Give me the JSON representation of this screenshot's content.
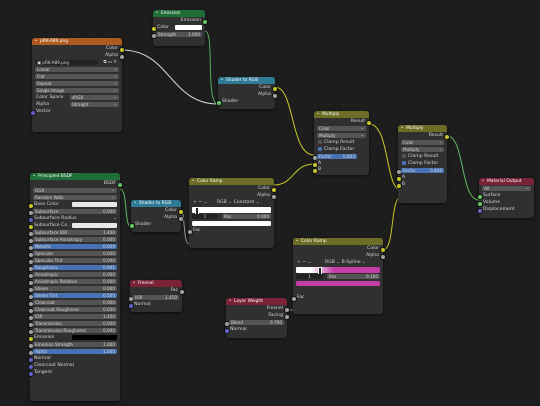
{
  "nodes": {
    "emission": {
      "title": "Emission",
      "out_emission": "Emission",
      "color_label": "Color",
      "strength_label": "Strength",
      "strength_value": "1.000"
    },
    "image": {
      "title": "pRK-A89.png",
      "out_color": "Color",
      "out_alpha": "Alpha",
      "file": "pRK-A89.png",
      "interpolation": "Linear",
      "projection": "Flat",
      "extension": "Repeat",
      "source": "Single Image",
      "cs_label": "Color Space",
      "cs_value": "sRGB",
      "alpha_label": "Alpha",
      "alpha_value": "Straight",
      "in_vector": "Vector"
    },
    "s2r1": {
      "title": "Shader to RGB",
      "out_color": "Color",
      "out_alpha": "Alpha",
      "in_shader": "Shader"
    },
    "multiply1": {
      "title": "Multiply",
      "out_result": "Result",
      "mode_type": "Color",
      "mode_blend": "Multiply",
      "clamp_result": "Clamp Result",
      "clamp_factor": "Clamp Factor",
      "factor_label": "Factor",
      "factor_value": "0.843",
      "in_a": "A",
      "in_b": "B"
    },
    "multiply2": {
      "title": "Multiply",
      "out_result": "Result",
      "mode_type": "Color",
      "mode_blend": "Multiply",
      "clamp_result": "Clamp Result",
      "clamp_factor": "Clamp Factor",
      "factor_label": "Factor",
      "factor_value": "0.848",
      "in_a": "A",
      "in_b": "B"
    },
    "material_output": {
      "title": "Material Output",
      "target": "All",
      "in_surface": "Surface",
      "in_volume": "Volume",
      "in_displacement": "Displacement"
    },
    "bsdf": {
      "title": "Principled BSDF",
      "out_bsdf": "BSDF",
      "distribution": "GGX",
      "subsurface_method": "Random Walk",
      "rows": [
        {
          "label": "Base Color",
          "value": "",
          "kind": "color"
        },
        {
          "label": "Subsurface",
          "value": "0.000",
          "kind": "num"
        },
        {
          "label": "Subsurface Radius",
          "value": "",
          "kind": "vec"
        },
        {
          "label": "Subsurface Co...",
          "value": "",
          "kind": "color"
        },
        {
          "label": "Subsurface IOR",
          "value": "1.400",
          "kind": "num"
        },
        {
          "label": "Subsurface Anisotropy",
          "value": "0.000",
          "kind": "num"
        },
        {
          "label": "Metallic",
          "value": "0.000",
          "kind": "num"
        },
        {
          "label": "Specular",
          "value": "0.000",
          "kind": "num"
        },
        {
          "label": "Specular Tint",
          "value": "0.000",
          "kind": "num"
        },
        {
          "label": "Roughness",
          "value": "0.941",
          "kind": "num"
        },
        {
          "label": "Anisotropic",
          "value": "0.000",
          "kind": "num"
        },
        {
          "label": "Anisotropic Rotation",
          "value": "0.000",
          "kind": "num"
        },
        {
          "label": "Sheen",
          "value": "0.000",
          "kind": "num"
        },
        {
          "label": "Sheen Tint",
          "value": "0.500",
          "kind": "num"
        },
        {
          "label": "Clearcoat",
          "value": "0.000",
          "kind": "num"
        },
        {
          "label": "Clearcoat Roughness",
          "value": "0.030",
          "kind": "num"
        },
        {
          "label": "IOR",
          "value": "1.450",
          "kind": "num"
        },
        {
          "label": "Transmission",
          "value": "0.000",
          "kind": "num"
        },
        {
          "label": "Transmission Roughness",
          "value": "0.000",
          "kind": "num"
        },
        {
          "label": "Emission",
          "value": "",
          "kind": "color"
        },
        {
          "label": "Emission Strength",
          "value": "1.000",
          "kind": "num"
        },
        {
          "label": "Alpha",
          "value": "1.000",
          "kind": "num"
        },
        {
          "label": "Normal",
          "value": "",
          "kind": "sock"
        },
        {
          "label": "Clearcoat Normal",
          "value": "",
          "kind": "sock"
        },
        {
          "label": "Tangent",
          "value": "",
          "kind": "sock"
        }
      ]
    },
    "s2r2": {
      "title": "Shader to RGB",
      "out_color": "Color",
      "out_alpha": "Alpha",
      "in_shader": "Shader"
    },
    "ramp1": {
      "title": "Color Ramp",
      "out_color": "Color",
      "out_alpha": "Alpha",
      "mode": "RGB",
      "interp": "Constant",
      "stop_index": "1",
      "pos_label": "Pos",
      "pos_value": "0.000",
      "in_fac": "Fac"
    },
    "ramp2": {
      "title": "Color Ramp",
      "out_color": "Color",
      "out_alpha": "Alpha",
      "mode": "RGB",
      "interp": "B-Spline",
      "stop_index": "1",
      "pos_label": "Pos",
      "pos_value": "0.100",
      "in_fac": "Fac"
    },
    "fresnel": {
      "title": "Fresnel",
      "out_fac": "Fac",
      "ior_label": "IOR",
      "ior_value": "1.450",
      "in_normal": "Normal"
    },
    "layer_weight": {
      "title": "Layer Weight",
      "out_fresnel": "Fresnel",
      "out_facing": "Facing",
      "blend_label": "Blend",
      "blend_value": "0.700",
      "in_normal": "Normal"
    }
  },
  "colors": {
    "shader_header": "#1f6e38",
    "texture_header": "#ad5b21",
    "converter_header": "#2f7a95",
    "color_header": "#6d6d25",
    "output_header": "#7a2236",
    "input_header": "#7a2236",
    "socket_color": "#c7c729",
    "socket_shader": "#63c763",
    "socket_float": "#a1a1a1",
    "socket_vector": "#6363c7",
    "selected_field": "#4772b3",
    "ramp2_pink": "#c43ea8"
  }
}
